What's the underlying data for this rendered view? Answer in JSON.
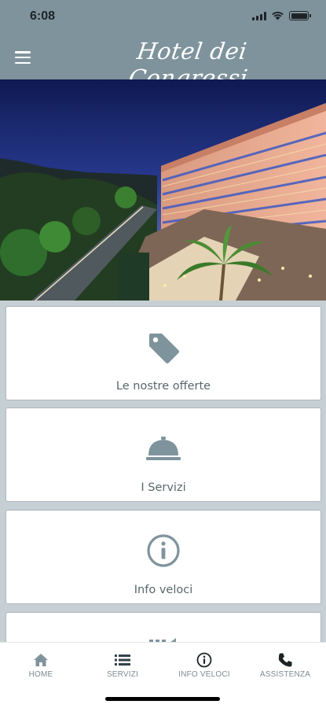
{
  "status_bar": {
    "time": "6:08"
  },
  "header": {
    "title": "Hotel dei Congressi"
  },
  "colors": {
    "header_bg": "#7f939c",
    "page_bg": "#c6cfd3",
    "icon": "#7f939c",
    "label": "#5a666c",
    "tab_text": "#7d8b91"
  },
  "hero": {
    "icon": "hotel-photo"
  },
  "cards": [
    {
      "label": "Le nostre offerte",
      "icon": "tag-icon"
    },
    {
      "label": "I Servizi",
      "icon": "cloche-icon"
    },
    {
      "label": "Info veloci",
      "icon": "info-icon"
    },
    {
      "label": "",
      "icon": "partial-icon"
    }
  ],
  "tabbar": {
    "items": [
      {
        "label": "HOME",
        "icon": "home-icon"
      },
      {
        "label": "SERVIZI",
        "icon": "list-icon"
      },
      {
        "label": "INFO VELOCI",
        "icon": "info-icon"
      },
      {
        "label": "ASSISTENZA",
        "icon": "phone-icon"
      }
    ]
  }
}
